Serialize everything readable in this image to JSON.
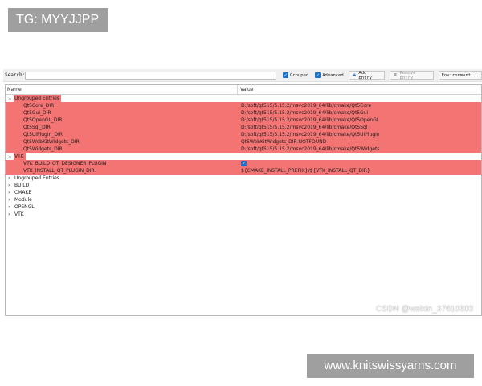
{
  "badges": {
    "top_left": "TG: MYYJJPP",
    "bottom_right": "www.knitswissyarns.com",
    "credit": "CSDN @weixin_37610603"
  },
  "toolbar": {
    "search_label": "Search:",
    "search_value": "",
    "grouped_label": "Grouped",
    "grouped_checked": true,
    "advanced_label": "Advanced",
    "advanced_checked": true,
    "add_entry_label": "Add Entry",
    "remove_entry_label": "Remove Entry",
    "environment_label": "Environment..."
  },
  "table": {
    "col_name": "Name",
    "col_value": "Value",
    "groups": [
      {
        "name": "Ungrouped Entries",
        "expanded": true,
        "highlight": true,
        "entries": [
          {
            "name": "Qt5Core_DIR",
            "value": "D:/soft/qt515/5.15.2/msvc2019_64/lib/cmake/Qt5Core"
          },
          {
            "name": "Qt5Gui_DIR",
            "value": "D:/soft/qt515/5.15.2/msvc2019_64/lib/cmake/Qt5Gui"
          },
          {
            "name": "Qt5OpenGL_DIR",
            "value": "D:/soft/qt515/5.15.2/msvc2019_64/lib/cmake/Qt5OpenGL"
          },
          {
            "name": "Qt5Sql_DIR",
            "value": "D:/soft/qt515/5.15.2/msvc2019_64/lib/cmake/Qt5Sql"
          },
          {
            "name": "Qt5UiPlugin_DIR",
            "value": "D:/soft/qt515/5.15.2/msvc2019_64/lib/cmake/Qt5UiPlugin"
          },
          {
            "name": "Qt5WebKitWidgets_DIR",
            "value": "Qt5WebKitWidgets_DIR-NOTFOUND"
          },
          {
            "name": "Qt5Widgets_DIR",
            "value": "D:/soft/qt515/5.15.2/msvc2019_64/lib/cmake/Qt5Widgets"
          }
        ]
      },
      {
        "name": "VTK",
        "expanded": true,
        "highlight": true,
        "entries": [
          {
            "name": "VTK_BUILD_QT_DESIGNER_PLUGIN",
            "value": "",
            "checkbox": true
          },
          {
            "name": "VTK_INSTALL_QT_PLUGIN_DIR",
            "value": "${CMAKE_INSTALL_PREFIX}/${VTK_INSTALL_QT_DIR}"
          }
        ]
      },
      {
        "name": "Ungrouped Entries",
        "expanded": false,
        "highlight": false,
        "entries": []
      },
      {
        "name": "BUILD",
        "expanded": false,
        "highlight": false,
        "entries": []
      },
      {
        "name": "CMAKE",
        "expanded": false,
        "highlight": false,
        "entries": []
      },
      {
        "name": "Module",
        "expanded": false,
        "highlight": false,
        "entries": []
      },
      {
        "name": "OPENGL",
        "expanded": false,
        "highlight": false,
        "entries": []
      },
      {
        "name": "VTK",
        "expanded": false,
        "highlight": false,
        "entries": []
      }
    ]
  },
  "colors": {
    "highlight_red": "#f47373",
    "checkbox_blue": "#1a73c8",
    "badge_gray": "#9f9f9f"
  },
  "icons": {
    "expanded": "chevron-down-icon",
    "collapsed": "chevron-right-icon",
    "add": "plus-icon",
    "remove": "remove-icon",
    "check": "checkmark-icon"
  }
}
